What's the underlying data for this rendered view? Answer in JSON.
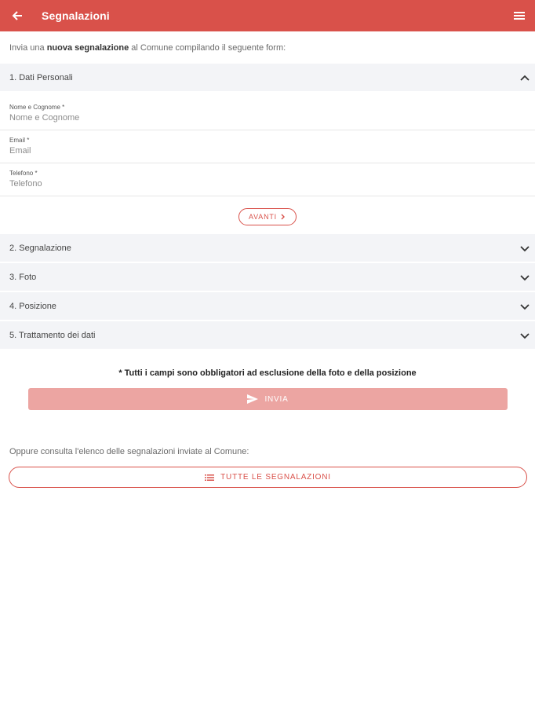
{
  "app": {
    "title": "Segnalazioni",
    "accent": "#d9514a"
  },
  "intro": {
    "prefix": "Invia una ",
    "bold": "nuova segnalazione",
    "suffix": " al Comune compilando il seguente form:"
  },
  "sections": [
    {
      "label": "1. Dati Personali",
      "expanded": true
    },
    {
      "label": "2. Segnalazione",
      "expanded": false
    },
    {
      "label": "3. Foto",
      "expanded": false
    },
    {
      "label": "4. Posizione",
      "expanded": false
    },
    {
      "label": "5. Trattamento dei dati",
      "expanded": false
    }
  ],
  "fields": [
    {
      "label": "Nome e Cognome *",
      "placeholder": "Nome e Cognome",
      "value": ""
    },
    {
      "label": "Email *",
      "placeholder": "Email",
      "value": ""
    },
    {
      "label": "Telefono *",
      "placeholder": "Telefono",
      "value": ""
    }
  ],
  "buttons": {
    "avanti": "AVANTI",
    "invia": "INVIA",
    "tutte": "TUTTE LE SEGNALAZIONI"
  },
  "note": "* Tutti i campi sono obbligatori ad esclusione della foto e della posizione",
  "oppure": "Oppure consulta l'elenco delle segnalazioni inviate al Comune:",
  "icons": {
    "back": "arrow-left",
    "menu": "hamburger",
    "collapse": "chevron-up",
    "expand": "chevron-down",
    "next": "chevron-right",
    "send": "paper-plane",
    "list": "list"
  }
}
